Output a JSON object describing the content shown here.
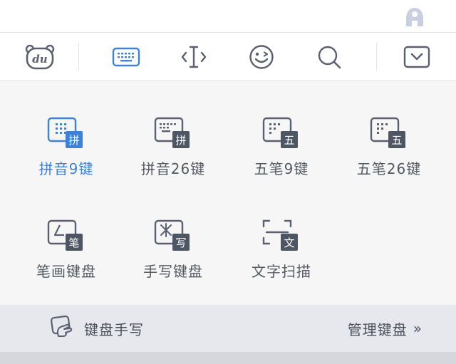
{
  "colors": {
    "accent": "#3d82d8",
    "icon_dark": "#5a6070",
    "badge_dark": "#4e5563",
    "text": "#555a62",
    "bottom_bar": "#e6e8ed"
  },
  "top_bar": {
    "icon": "account-a-icon"
  },
  "toolbar": {
    "items": [
      {
        "name": "du-logo-icon"
      },
      {
        "name": "keyboard-icon",
        "active": true
      },
      {
        "name": "cursor-move-icon"
      },
      {
        "name": "emoji-icon"
      },
      {
        "name": "search-icon"
      },
      {
        "name": "collapse-keyboard-icon"
      }
    ]
  },
  "keyboards": [
    {
      "label": "拼音9键",
      "badge": "拼",
      "type": "9key",
      "active": true
    },
    {
      "label": "拼音26键",
      "badge": "拼",
      "type": "26key",
      "active": false
    },
    {
      "label": "五笔9键",
      "badge": "五",
      "type": "9key",
      "active": false
    },
    {
      "label": "五笔26键",
      "badge": "五",
      "type": "26key",
      "active": false
    },
    {
      "label": "笔画键盘",
      "badge": "笔",
      "type": "stroke",
      "active": false
    },
    {
      "label": "手写键盘",
      "badge": "写",
      "type": "handwrite",
      "active": false
    },
    {
      "label": "文字扫描",
      "badge": "文",
      "type": "scan",
      "active": false
    }
  ],
  "bottom_bar": {
    "handwrite_label": "键盘手写",
    "manage_label": "管理键盘",
    "manage_chevron": "»"
  }
}
